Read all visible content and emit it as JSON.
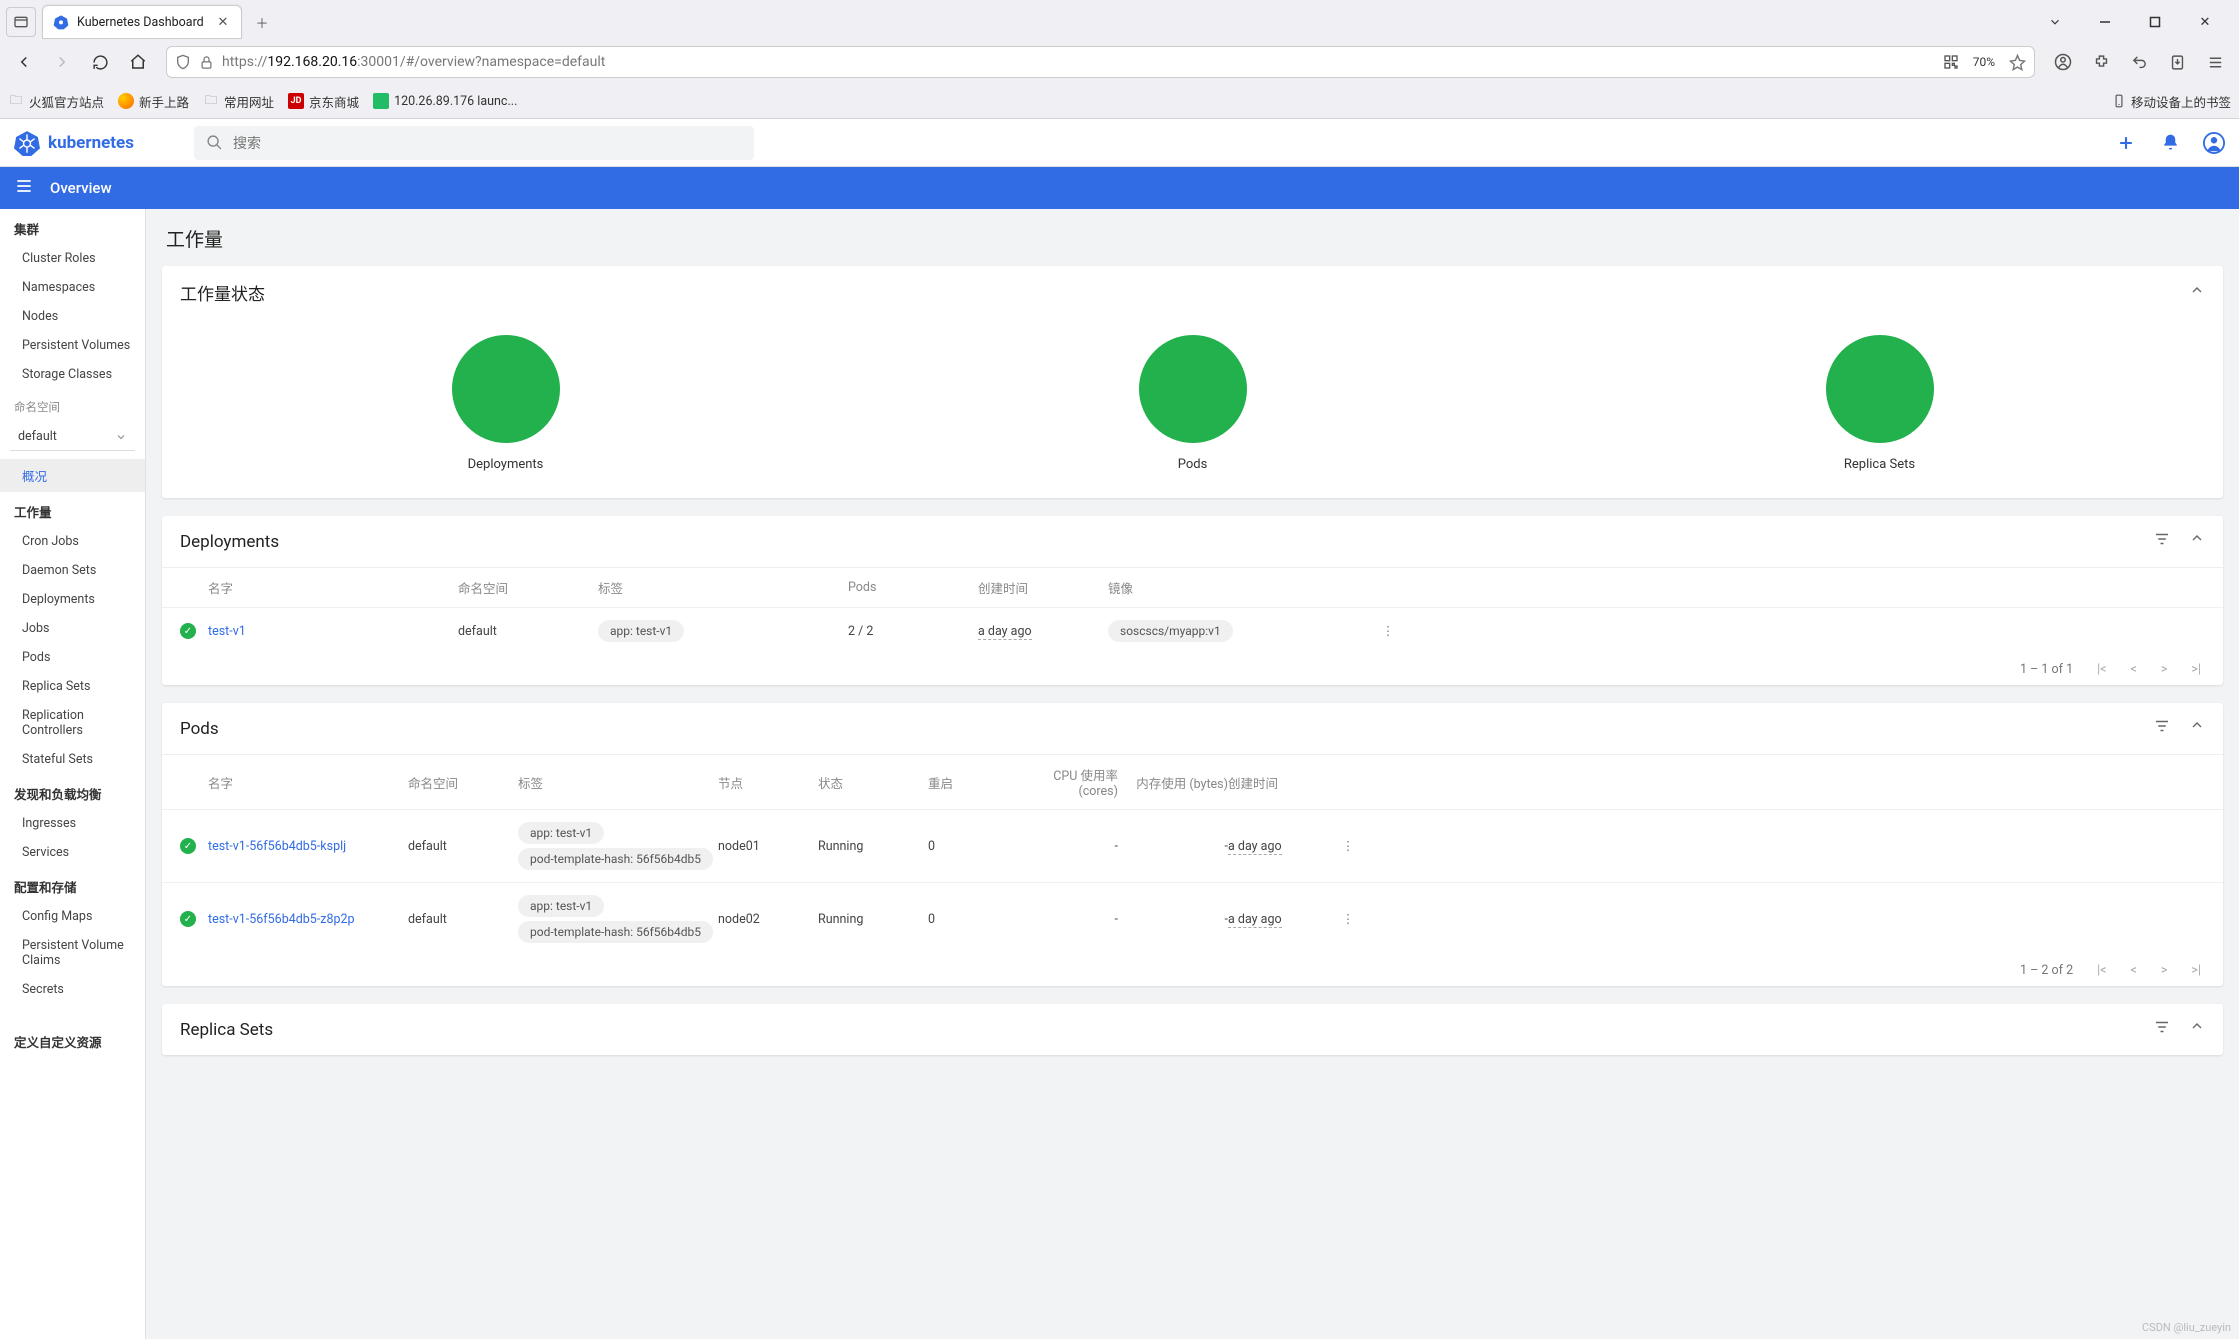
{
  "browser": {
    "tab_title": "Kubernetes Dashboard",
    "url_prefix": "https://",
    "url_host": "192.168.20.16",
    "url_suffix": ":30001/#/overview?namespace=default",
    "zoom": "70%",
    "bookmarks": {
      "b1": "火狐官方站点",
      "b2": "新手上路",
      "b3": "常用网址",
      "b4": "京东商城",
      "b5": "120.26.89.176 launc...",
      "right": "移动设备上的书签"
    }
  },
  "k8s": {
    "brand": "kubernetes",
    "search_placeholder": "搜索",
    "subheader": "Overview"
  },
  "sidebar": {
    "cluster_header": "集群",
    "cluster": {
      "cluster_roles": "Cluster Roles",
      "namespaces": "Namespaces",
      "nodes": "Nodes",
      "pv": "Persistent Volumes",
      "sc": "Storage Classes"
    },
    "ns_label": "命名空间",
    "ns_value": "default",
    "overview": "概况",
    "workloads_header": "工作量",
    "workloads": {
      "cronjobs": "Cron Jobs",
      "ds": "Daemon Sets",
      "deploy": "Deployments",
      "jobs": "Jobs",
      "pods": "Pods",
      "rs": "Replica Sets",
      "rc": "Replication Controllers",
      "ss": "Stateful Sets"
    },
    "discovery_header": "发现和负载均衡",
    "discovery": {
      "ingresses": "Ingresses",
      "services": "Services"
    },
    "config_header": "配置和存储",
    "config": {
      "cm": "Config Maps",
      "pvc": "Persistent Volume Claims",
      "secrets": "Secrets"
    },
    "crd_header": "定义自定义资源"
  },
  "main": {
    "title": "工作量",
    "status_card": {
      "title": "工作量状态",
      "deployments": "Deployments",
      "pods": "Pods",
      "rs": "Replica Sets"
    },
    "deploy_card": {
      "title": "Deployments",
      "cols": {
        "name": "名字",
        "ns": "命名空间",
        "labels": "标签",
        "pods": "Pods",
        "created": "创建时间",
        "images": "镜像"
      },
      "rows": [
        {
          "name": "test-v1",
          "ns": "default",
          "label1": "app: test-v1",
          "pods": "2 / 2",
          "created": "a day ago",
          "image": "soscscs/myapp:v1"
        }
      ],
      "pager": "1 – 1 of 1"
    },
    "pods_card": {
      "title": "Pods",
      "cols": {
        "name": "名字",
        "ns": "命名空间",
        "labels": "标签",
        "node": "节点",
        "status": "状态",
        "restarts": "重启",
        "cpu": "CPU 使用率 (cores)",
        "mem": "内存使用 (bytes)",
        "created": "创建时间"
      },
      "rows": [
        {
          "name": "test-v1-56f56b4db5-ksplj",
          "ns": "default",
          "label1": "app: test-v1",
          "label2": "pod-template-hash: 56f56b4db5",
          "node": "node01",
          "status": "Running",
          "restarts": "0",
          "cpu": "-",
          "mem": "-",
          "created": "a day ago"
        },
        {
          "name": "test-v1-56f56b4db5-z8p2p",
          "ns": "default",
          "label1": "app: test-v1",
          "label2": "pod-template-hash: 56f56b4db5",
          "node": "node02",
          "status": "Running",
          "restarts": "0",
          "cpu": "-",
          "mem": "-",
          "created": "a day ago"
        }
      ],
      "pager": "1 – 2 of 2"
    },
    "rs_card": {
      "title": "Replica Sets"
    }
  },
  "watermark": "CSDN @liu_zueyin"
}
